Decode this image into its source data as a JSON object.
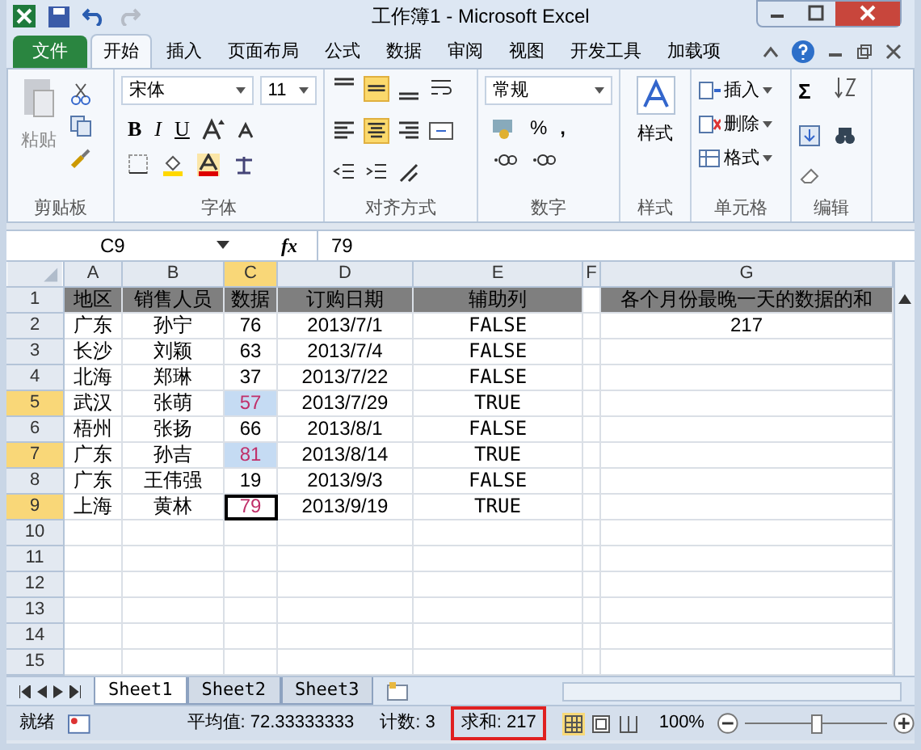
{
  "window": {
    "title": "工作簿1 - Microsoft Excel"
  },
  "tabs": [
    {
      "label": "文件",
      "kind": "file",
      "selected": false
    },
    {
      "label": "开始",
      "kind": "tab",
      "selected": true
    },
    {
      "label": "插入",
      "kind": "tab",
      "selected": false
    },
    {
      "label": "页面布局",
      "kind": "tab",
      "selected": false
    },
    {
      "label": "公式",
      "kind": "tab",
      "selected": false
    },
    {
      "label": "数据",
      "kind": "tab",
      "selected": false
    },
    {
      "label": "审阅",
      "kind": "tab",
      "selected": false
    },
    {
      "label": "视图",
      "kind": "tab",
      "selected": false
    },
    {
      "label": "开发工具",
      "kind": "tab",
      "selected": false
    },
    {
      "label": "加载项",
      "kind": "tab",
      "selected": false
    }
  ],
  "ribbon": {
    "clipboard": {
      "label": "剪贴板",
      "paste": "粘贴"
    },
    "font": {
      "label": "字体",
      "font_name": "宋体",
      "font_size": "11",
      "bold": "B",
      "italic": "I",
      "underline": "U"
    },
    "alignment": {
      "label": "对齐方式",
      "middle_align_selected": true,
      "center_selected": true
    },
    "number": {
      "label": "数字",
      "format": "常规",
      "percent": "%",
      "comma": ","
    },
    "styles": {
      "label": "样式",
      "button": "样式"
    },
    "cells": {
      "label": "单元格",
      "items": [
        "插入",
        "删除",
        "格式"
      ]
    },
    "editing": {
      "label": "编辑",
      "sum": "Σ"
    }
  },
  "formula_bar": {
    "name_box": "C9",
    "fx": "fx",
    "value": "79"
  },
  "columns": [
    {
      "label": "A",
      "selected": false
    },
    {
      "label": "B",
      "selected": false
    },
    {
      "label": "C",
      "selected": true
    },
    {
      "label": "D",
      "selected": false
    },
    {
      "label": "E",
      "selected": false
    },
    {
      "label": "F",
      "selected": false
    },
    {
      "label": "G",
      "selected": false
    }
  ],
  "rows": [
    {
      "header": "1",
      "selected": false,
      "kind": "heading",
      "cells": {
        "A": "地区",
        "B": "销售人员",
        "C": "数据",
        "D": "订购日期",
        "E": "辅助列",
        "G": "各个月份最晚一天的数据的和"
      }
    },
    {
      "header": "2",
      "selected": false,
      "kind": "data",
      "c_highlighted": false,
      "c_active": false,
      "cells": {
        "A": "广东",
        "B": "孙宁",
        "C": "76",
        "D": "2013/7/1",
        "E": "FALSE",
        "G": "217"
      }
    },
    {
      "header": "3",
      "selected": false,
      "kind": "data",
      "c_highlighted": false,
      "c_active": false,
      "cells": {
        "A": "长沙",
        "B": "刘颖",
        "C": "63",
        "D": "2013/7/4",
        "E": "FALSE"
      }
    },
    {
      "header": "4",
      "selected": false,
      "kind": "data",
      "c_highlighted": false,
      "c_active": false,
      "cells": {
        "A": "北海",
        "B": "郑琳",
        "C": "37",
        "D": "2013/7/22",
        "E": "FALSE"
      }
    },
    {
      "header": "5",
      "selected": true,
      "kind": "data",
      "c_highlighted": true,
      "c_active": false,
      "cells": {
        "A": "武汉",
        "B": "张萌",
        "C": "57",
        "D": "2013/7/29",
        "E": "TRUE"
      }
    },
    {
      "header": "6",
      "selected": false,
      "kind": "data",
      "c_highlighted": false,
      "c_active": false,
      "cells": {
        "A": "梧州",
        "B": "张扬",
        "C": "66",
        "D": "2013/8/1",
        "E": "FALSE"
      }
    },
    {
      "header": "7",
      "selected": true,
      "kind": "data",
      "c_highlighted": true,
      "c_active": false,
      "cells": {
        "A": "广东",
        "B": "孙吉",
        "C": "81",
        "D": "2013/8/14",
        "E": "TRUE"
      }
    },
    {
      "header": "8",
      "selected": false,
      "kind": "data",
      "c_highlighted": false,
      "c_active": false,
      "cells": {
        "A": "广东",
        "B": "王伟强",
        "C": "19",
        "D": "2013/9/3",
        "E": "FALSE"
      }
    },
    {
      "header": "9",
      "selected": true,
      "kind": "data",
      "c_highlighted": false,
      "c_active": true,
      "cells": {
        "A": "上海",
        "B": "黄林",
        "C": "79",
        "D": "2013/9/19",
        "E": "TRUE"
      }
    },
    {
      "header": "10",
      "selected": false,
      "kind": "empty"
    },
    {
      "header": "11",
      "selected": false,
      "kind": "empty"
    },
    {
      "header": "12",
      "selected": false,
      "kind": "empty"
    },
    {
      "header": "13",
      "selected": false,
      "kind": "empty"
    },
    {
      "header": "14",
      "selected": false,
      "kind": "empty"
    },
    {
      "header": "15",
      "selected": false,
      "kind": "empty"
    }
  ],
  "sheets": [
    {
      "label": "Sheet1",
      "selected": true
    },
    {
      "label": "Sheet2",
      "selected": false
    },
    {
      "label": "Sheet3",
      "selected": false
    }
  ],
  "status_bar": {
    "ready": "就绪",
    "average": "平均值: 72.33333333",
    "count": "计数: 3",
    "sum": "求和: 217",
    "sum_highlighted": true,
    "zoom": "100%"
  },
  "zoom_slider": {
    "level": 0.5
  }
}
